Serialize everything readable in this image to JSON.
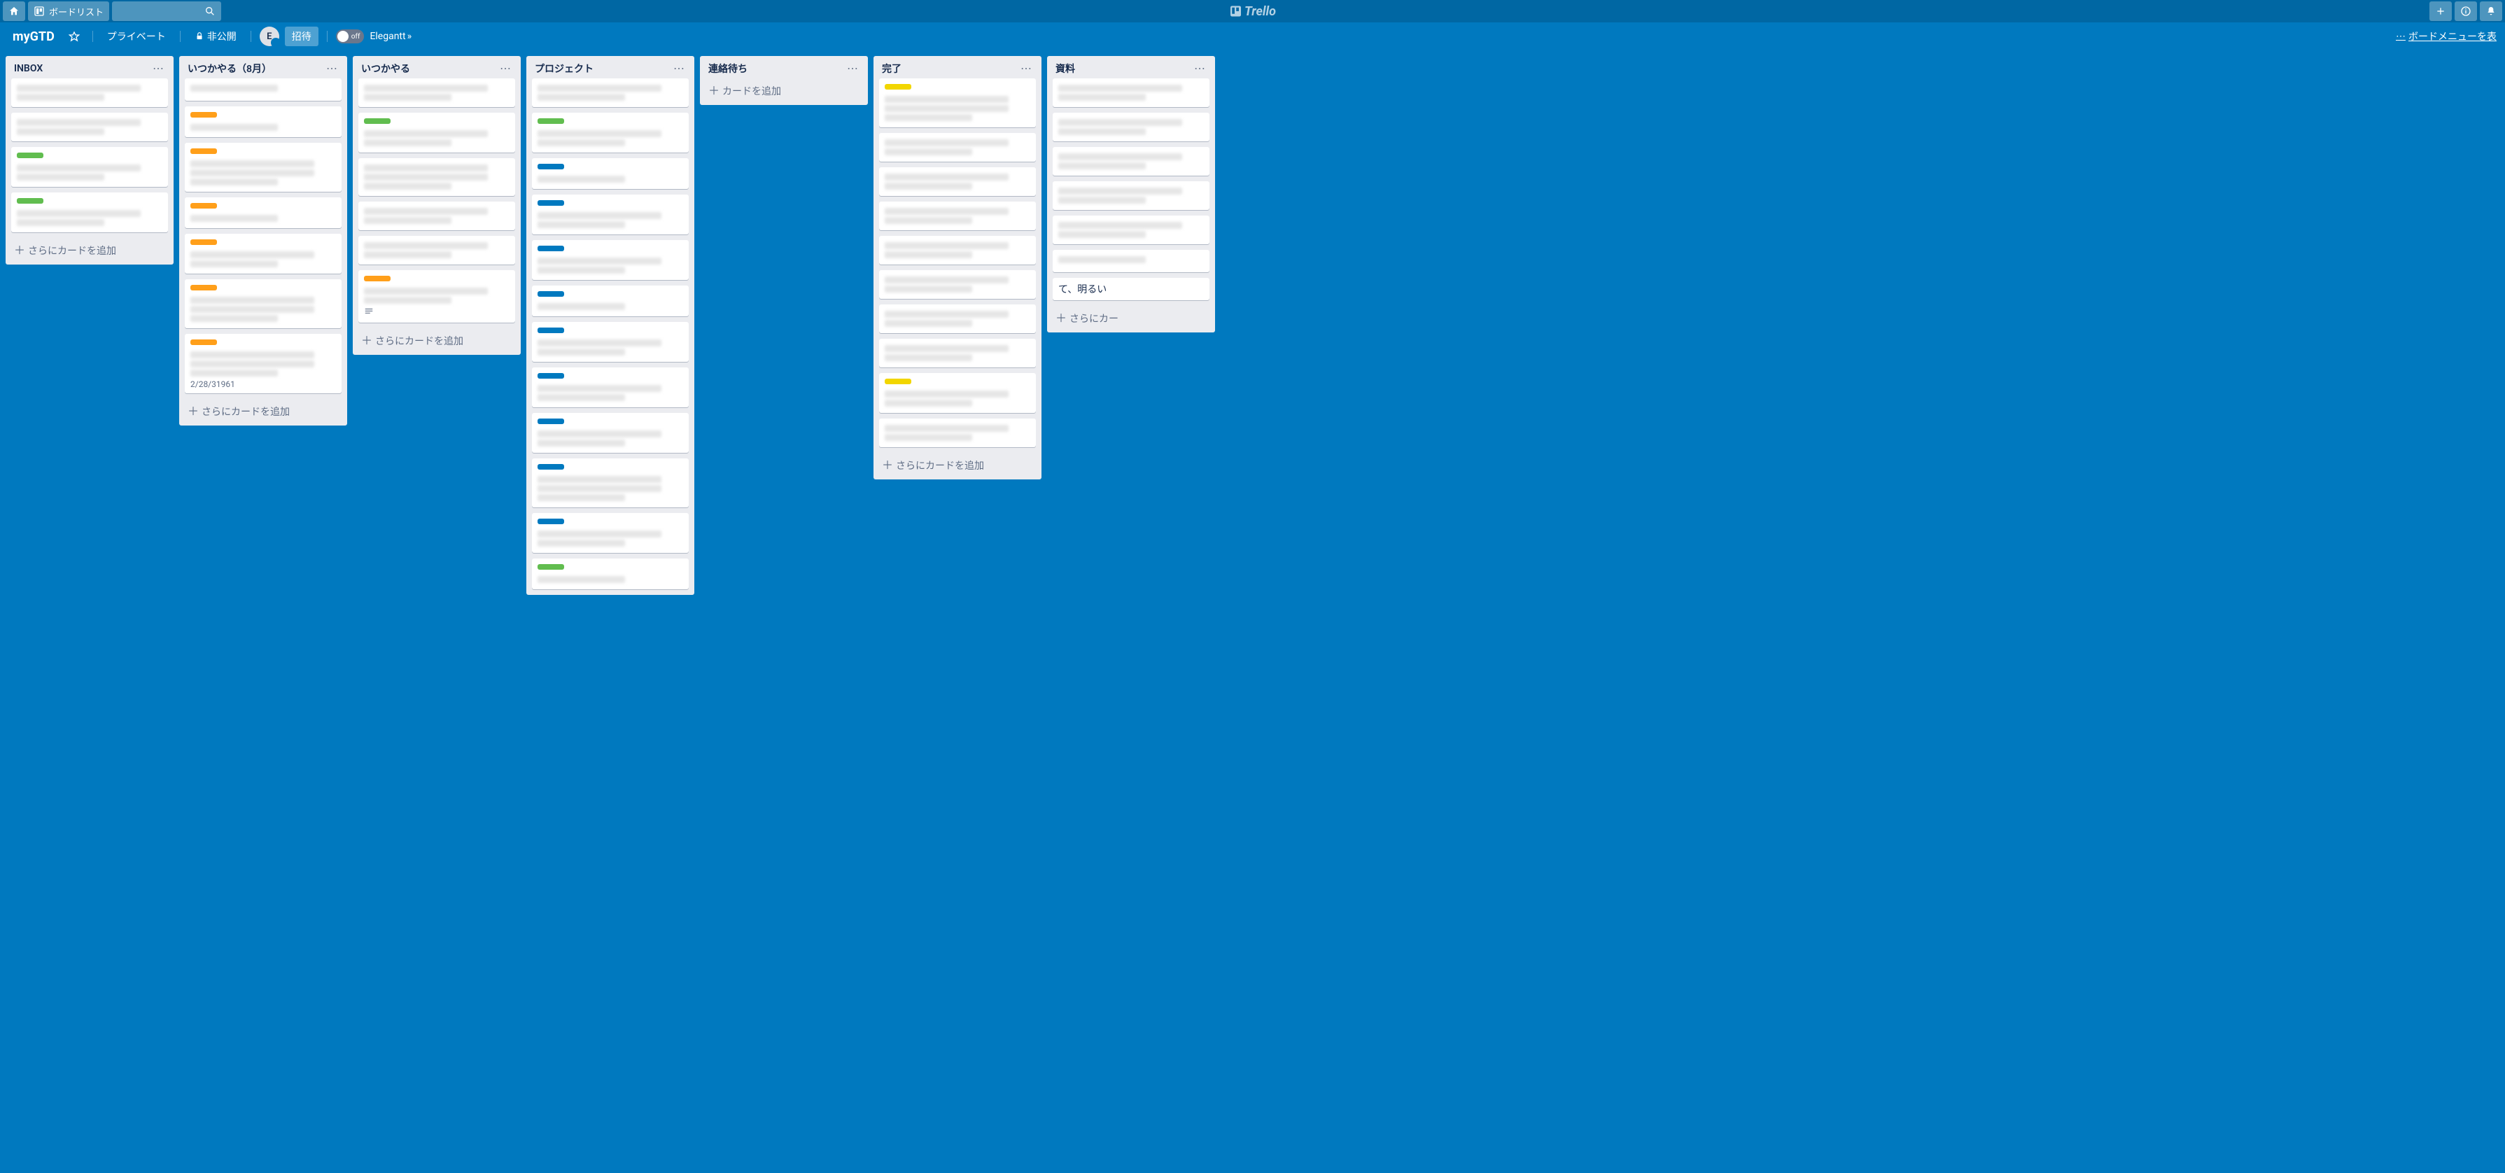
{
  "topbar": {
    "boards_button": "ボードリスト",
    "logo_text": "Trello"
  },
  "boardbar": {
    "board_name": "myGTD",
    "visibility_team": "プライベート",
    "visibility_private": "非公開",
    "member_initial": "E",
    "invite_label": "招待",
    "toggle_label": "off",
    "elegantt_label": "Elegantt",
    "show_menu": "ボードメニューを表"
  },
  "add_card_label": "さらにカードを追加",
  "add_card_label_short": "カードを追加",
  "add_card_label_trunc": "さらにカー",
  "lists": [
    {
      "title": "INBOX",
      "add": "full",
      "cards": [
        {
          "h": 2
        },
        {
          "h": 2
        },
        {
          "labels": [
            "green"
          ],
          "h": 2
        },
        {
          "labels": [
            "green"
          ],
          "h": 2
        }
      ]
    },
    {
      "title": "いつかやる（8月）",
      "add": "full",
      "cards": [
        {
          "h": 1
        },
        {
          "labels": [
            "orange"
          ],
          "h": 1
        },
        {
          "labels": [
            "orange"
          ],
          "h": 3
        },
        {
          "labels": [
            "orange"
          ],
          "h": 1
        },
        {
          "labels": [
            "orange"
          ],
          "h": 2
        },
        {
          "labels": [
            "orange"
          ],
          "h": 3
        },
        {
          "labels": [
            "orange"
          ],
          "h": 3,
          "meta": "2/28/31961"
        }
      ]
    },
    {
      "title": "いつかやる",
      "add": "full",
      "cards": [
        {
          "h": 2
        },
        {
          "labels": [
            "green"
          ],
          "h": 2
        },
        {
          "h": 3
        },
        {
          "h": 2
        },
        {
          "h": 2
        },
        {
          "labels": [
            "orange"
          ],
          "h": 2,
          "desc": true
        }
      ]
    },
    {
      "title": "プロジェクト",
      "add": "none",
      "cards": [
        {
          "h": 2
        },
        {
          "labels": [
            "green"
          ],
          "h": 2
        },
        {
          "labels": [
            "blue"
          ],
          "h": 1
        },
        {
          "labels": [
            "blue"
          ],
          "h": 2
        },
        {
          "labels": [
            "blue"
          ],
          "h": 2
        },
        {
          "labels": [
            "blue"
          ],
          "h": 1
        },
        {
          "labels": [
            "blue"
          ],
          "h": 2
        },
        {
          "labels": [
            "blue"
          ],
          "h": 2
        },
        {
          "labels": [
            "blue"
          ],
          "h": 2
        },
        {
          "labels": [
            "blue"
          ],
          "h": 3
        },
        {
          "labels": [
            "blue"
          ],
          "h": 2
        },
        {
          "labels": [
            "green"
          ],
          "h": 1
        }
      ]
    },
    {
      "title": "連絡待ち",
      "add": "short",
      "cards": []
    },
    {
      "title": "完了",
      "add": "full",
      "cards": [
        {
          "labels": [
            "yellow"
          ],
          "h": 3
        },
        {
          "h": 2
        },
        {
          "h": 2
        },
        {
          "h": 2
        },
        {
          "h": 2
        },
        {
          "h": 2
        },
        {
          "h": 2
        },
        {
          "h": 2
        },
        {
          "labels": [
            "yellow"
          ],
          "h": 2
        },
        {
          "h": 2
        }
      ]
    },
    {
      "title": "資料",
      "add": "trunc",
      "cards": [
        {
          "h": 2
        },
        {
          "h": 2
        },
        {
          "h": 2
        },
        {
          "h": 2
        },
        {
          "h": 2
        },
        {
          "h": 1
        },
        {
          "text": "て、明るい"
        }
      ]
    }
  ]
}
